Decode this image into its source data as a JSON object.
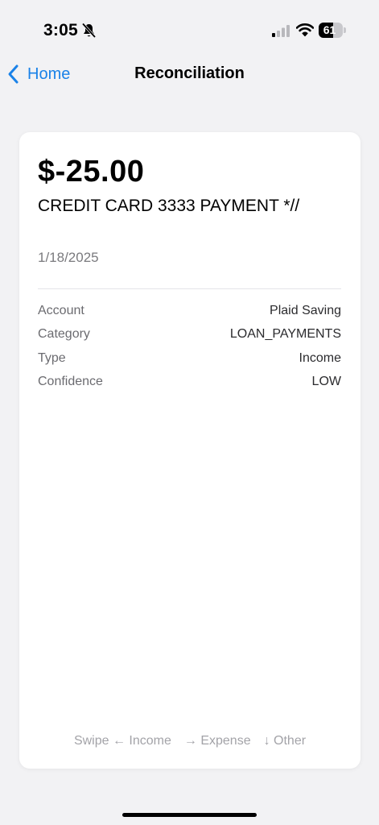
{
  "status_bar": {
    "time": "3:05",
    "battery_level": "61",
    "icons": [
      "bell-slash-icon",
      "cellular-signal-icon",
      "wifi-icon",
      "battery-icon"
    ]
  },
  "nav": {
    "back_label": "Home",
    "title": "Reconciliation",
    "accent_color": "#1a82e8"
  },
  "transaction": {
    "amount": "$-25.00",
    "description": "CREDIT CARD 3333 PAYMENT *//",
    "date": "1/18/2025",
    "details": [
      {
        "label": "Account",
        "value": "Plaid Saving"
      },
      {
        "label": "Category",
        "value": "LOAN_PAYMENTS"
      },
      {
        "label": "Type",
        "value": "Income"
      },
      {
        "label": "Confidence",
        "value": "LOW"
      }
    ]
  },
  "swipe_hint": {
    "income": "Swipe ← Income",
    "expense": "→ Expense",
    "other": "↓ Other"
  }
}
